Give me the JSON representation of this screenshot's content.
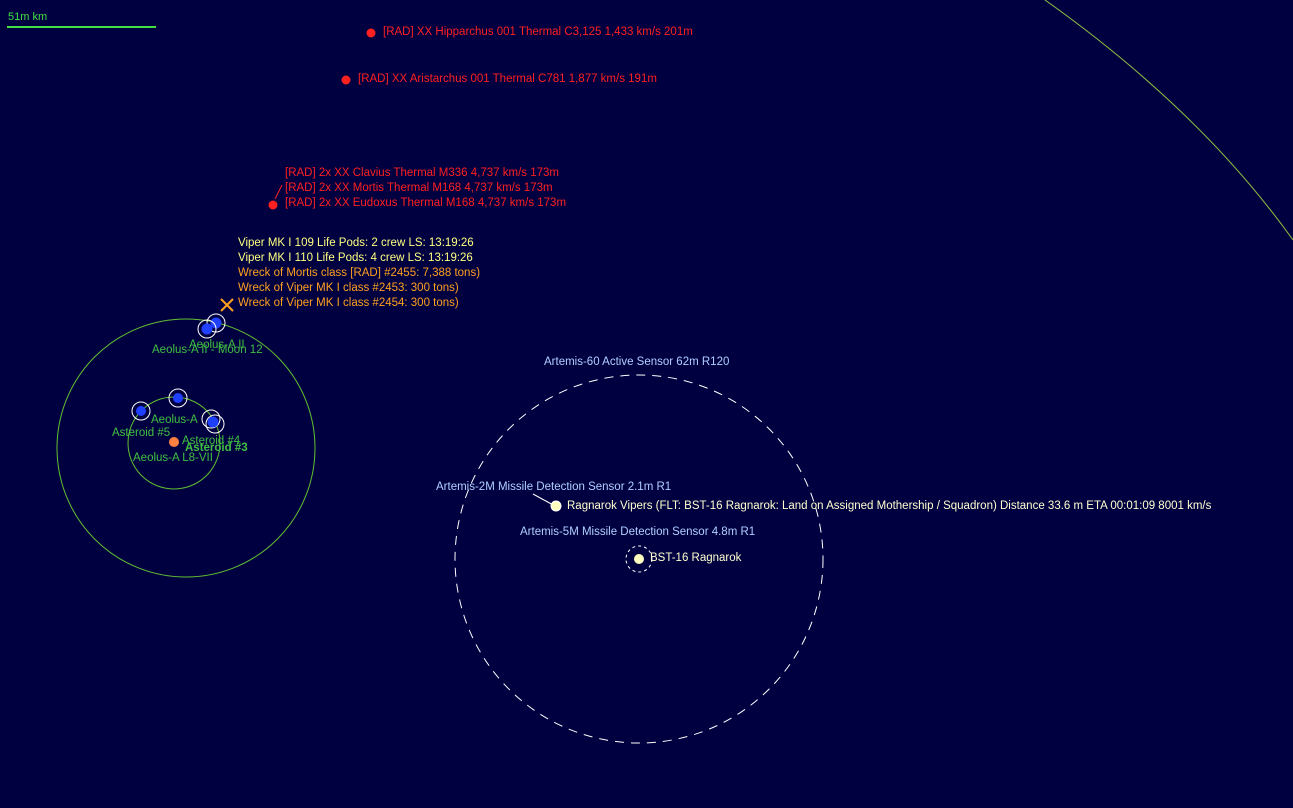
{
  "scale": {
    "label": "51m km"
  },
  "contacts": {
    "hipparchus": "[RAD]  XX Hipparchus 001   Thermal C3,125   1,433 km/s  201m",
    "aristarchus": "[RAD]  XX Aristarchus 001   Thermal C781   1,877 km/s  191m",
    "group": [
      "[RAD]  2x XX Clavius   Thermal M336   4,737 km/s  173m",
      "[RAD]  2x XX Mortis   Thermal M168   4,737 km/s  173m",
      "[RAD]  2x XX Eudoxus   Thermal M168   4,737 km/s  173m"
    ]
  },
  "lifepods": [
    "Viper MK I 109 Life Pods:  2 crew    LS: 13:19:26",
    "Viper MK I 110 Life Pods:  4 crew    LS: 13:19:26"
  ],
  "wrecks": [
    "Wreck of Mortis class [RAD] #2455: 7,388 tons)",
    "Wreck of Viper MK I class  #2453: 300 tons)",
    "Wreck of Viper MK I class  #2454: 300 tons)"
  ],
  "bodies": {
    "aeolus_a_ii": "Aeolus-A II",
    "aeolus_a_moon": "Aeolus-A II - Moon 12",
    "aeolus_a": "Aeolus-A",
    "asteroid5": "Asteroid #5",
    "asteroid4": "Asteroid #4",
    "asteroid3": "Asteroid #3",
    "aeolus_l8": "Aeolus-A L8-VII"
  },
  "sensors": {
    "active": "Artemis-60 Active Sensor  62m  R120",
    "missile2m": "Artemis-2M Missile Detection Sensor  2.1m  R1",
    "missile5m": "Artemis-5M Missile Detection Sensor  4.8m  R1"
  },
  "fleets": {
    "vipers": "Ragnarok Vipers  (FLT: BST-16 Ragnarok: Land on Assigned Mothership / Squadron)   Distance 33.6 m    ETA 00:01:09    8001 km/s",
    "ragnarok": "BST-16 Ragnarok"
  },
  "colors": {
    "background": "#000040",
    "hostile": "#ff2020",
    "orbit": "#40c040",
    "sensor": "#b0d0ff",
    "friendly": "#ffffd0",
    "wreck": "#ffa020"
  }
}
